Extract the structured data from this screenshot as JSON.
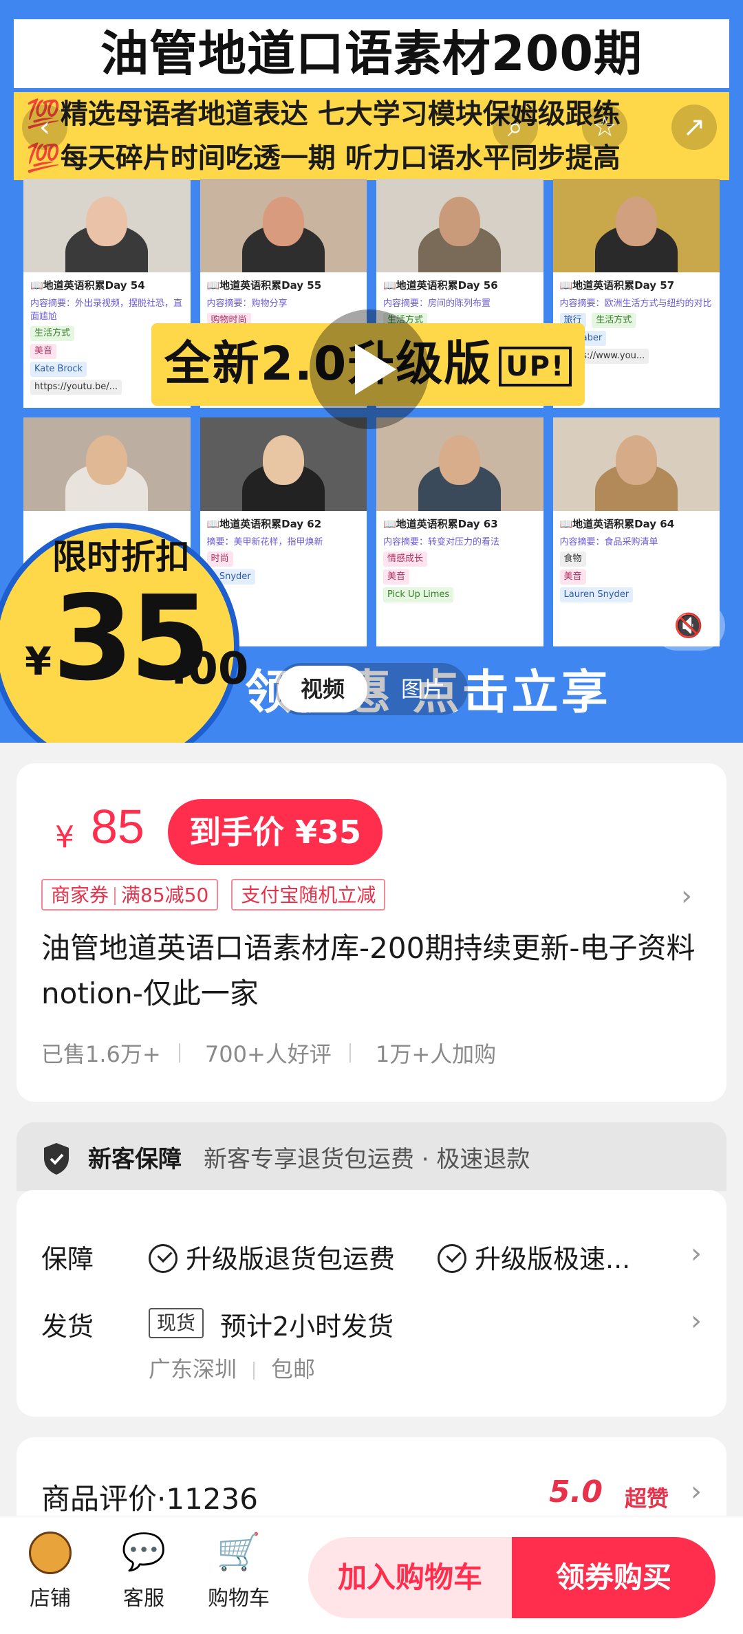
{
  "hero": {
    "title": "油管地道口语素材200期",
    "subtitle_1": "💯精选母语者地道表达 七大学习模块保姆级跟练",
    "subtitle_2": "💯每天碎片时间吃透一期 听力口语水平同步提高",
    "banner": "全新2.0升级版",
    "banner_badge": "UP!",
    "discount_label": "限时折扣",
    "discount_yen": "¥",
    "discount_int": "35",
    "discount_dec": ".00",
    "bottom_text": "领优惠 点击立享",
    "media_video": "视频",
    "media_image": "图片",
    "mute_icon": "🔇",
    "cards": [
      {
        "day": "📖地道英语积累Day 54",
        "summary": "内容摘要：外出录视频，摆脱社恐，直面尴尬",
        "tags": [
          "生活方式",
          "美音",
          "Kate Brock",
          "https://youtu.be/..."
        ]
      },
      {
        "day": "📖地道英语积累Day 55",
        "summary": "内容摘要：购物分享",
        "tags": [
          "购物时尚"
        ]
      },
      {
        "day": "📖地道英语积累Day 56",
        "summary": "内容摘要：房间的陈列布置",
        "tags": [
          "生活方式"
        ]
      },
      {
        "day": "📖地道英语积累Day 57",
        "summary": "内容摘要：欧洲生活方式与纽约的对比",
        "tags": [
          "旅行",
          "生活方式",
          "na Taber",
          "https://www.you..."
        ]
      },
      {
        "day": "",
        "summary": "",
        "tags": []
      },
      {
        "day": "📖地道英语积累Day 62",
        "summary": "摘要：美甲新花样，指甲焕新",
        "tags": [
          "时尚",
          "n Snyder"
        ]
      },
      {
        "day": "📖地道英语积累Day 63",
        "summary": "内容摘要：转变对压力的看法",
        "tags": [
          "情感成长",
          "美音",
          "Pick Up Limes"
        ]
      },
      {
        "day": "📖地道英语积累Day 64",
        "summary": "内容摘要：食品采购清单",
        "tags": [
          "食物",
          "美音",
          "Lauren Snyder"
        ]
      }
    ]
  },
  "price": {
    "yen": "¥",
    "original": "85",
    "final_label": "到手价 ¥35",
    "coupons": [
      {
        "a": "商家券",
        "b": "满85减50"
      },
      {
        "a": "支付宝随机立减",
        "b": ""
      }
    ],
    "title": "油管地道英语口语素材库-200期持续更新-电子资料notion-仅此一家",
    "stats": [
      "已售1.6万+",
      "700+人好评",
      "1万+人加购"
    ]
  },
  "guarantee": {
    "title": "新客保障",
    "desc": "新客专享退货包运费 · 极速退款"
  },
  "service": {
    "protect_label": "保障",
    "protect_items": [
      "升级版退货包运费",
      "升级版极速..."
    ],
    "ship_label": "发货",
    "stock_tag": "现货",
    "ship_text": "预计2小时发货",
    "ship_from": "广东深圳",
    "ship_free": "包邮"
  },
  "reviews": {
    "title": "商品评价·11236",
    "score": "5.0",
    "score_label": "超赞"
  },
  "bottom_bar": {
    "store": "店铺",
    "service": "客服",
    "cart": "购物车",
    "add_cart": "加入购物车",
    "buy": "领券购买"
  }
}
